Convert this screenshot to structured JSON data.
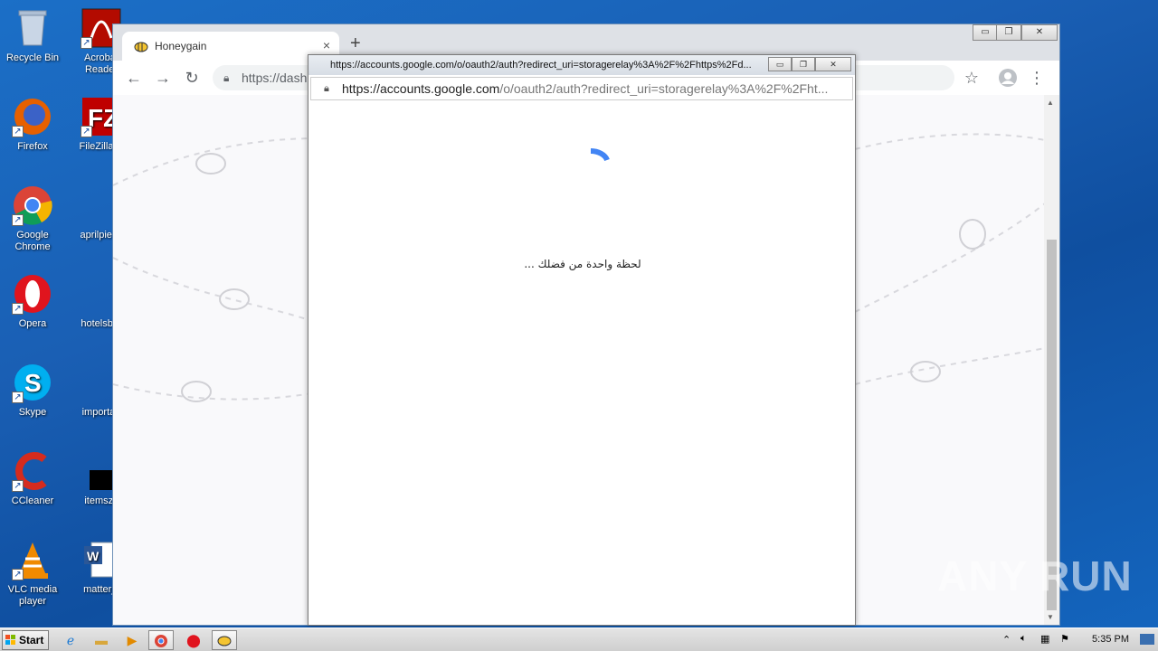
{
  "desktop": {
    "icons": [
      {
        "label": "Recycle Bin"
      },
      {
        "label": "Acrobat Reader"
      },
      {
        "label": "Firefox"
      },
      {
        "label": "FileZilla C"
      },
      {
        "label": "Google Chrome"
      },
      {
        "label": "aprilpiece"
      },
      {
        "label": "Opera"
      },
      {
        "label": "hotelsbor"
      },
      {
        "label": "Skype"
      },
      {
        "label": "importan"
      },
      {
        "label": "CCleaner"
      },
      {
        "label": "itemsz.j"
      },
      {
        "label": "VLC media player"
      },
      {
        "label": "matterjo"
      }
    ]
  },
  "browser": {
    "tab_title": "Honeygain",
    "new_tab": "+",
    "tab_close": "×",
    "omnibox_text": "https://dash",
    "colors": {
      "accent": "#4285f4"
    }
  },
  "popup": {
    "title": "https://accounts.google.com/o/oauth2/auth?redirect_uri=storagerelay%3A%2F%2Fhttps%2Fd...",
    "url_domain": "https://accounts.google.com",
    "url_path": "/o/oauth2/auth?redirect_uri=storagerelay%3A%2F%2Fht...",
    "message": "لحظة واحدة من فضلك ..."
  },
  "taskbar": {
    "start_label": "Start",
    "clock": "5:35 PM"
  },
  "watermark": "ANY RUN"
}
